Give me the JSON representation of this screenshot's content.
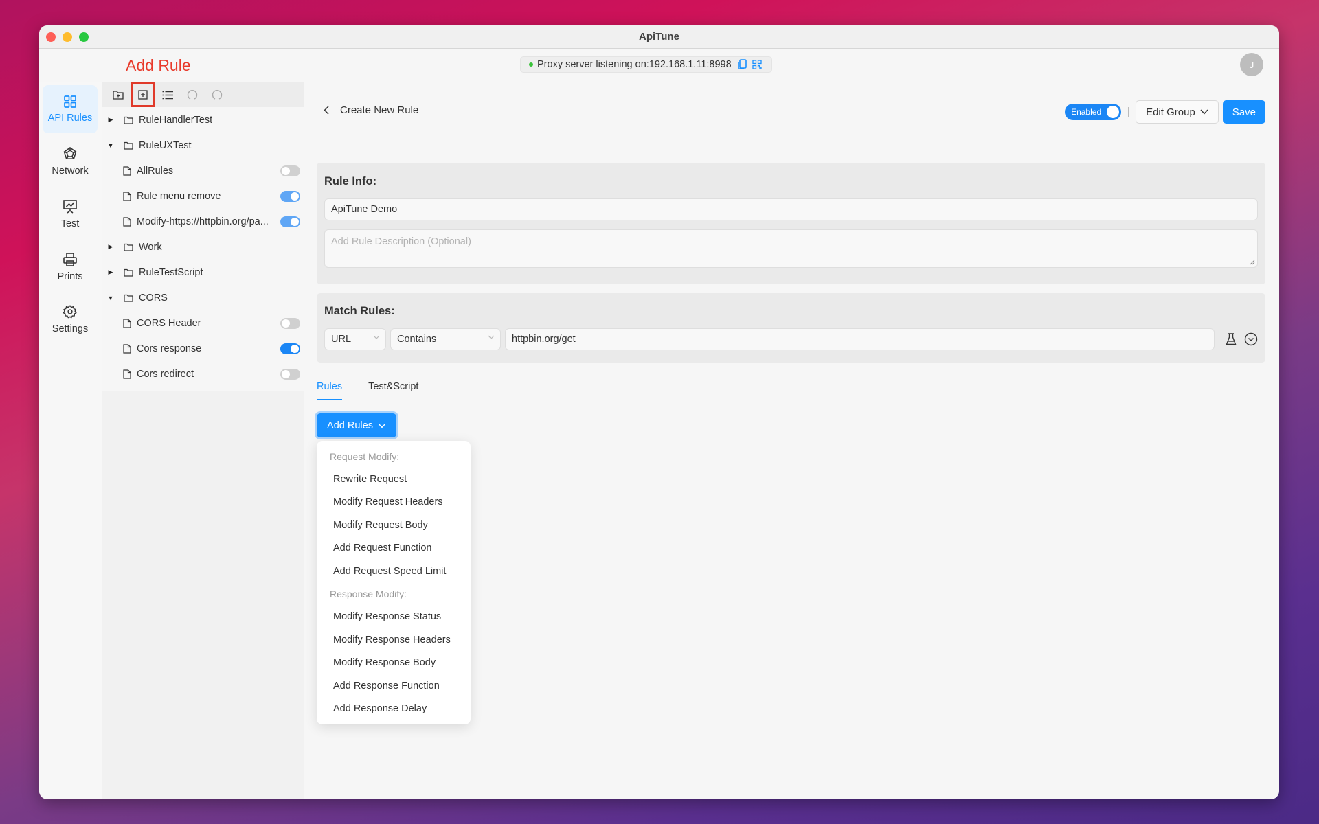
{
  "window": {
    "title": "ApiTune"
  },
  "annotation": {
    "label": "Add Rule",
    "color": "#e8392a"
  },
  "proxy": {
    "status_text": "Proxy server listening on:192.168.1.11:8998",
    "status_color": "#3ac23a",
    "copy_icon": "copy-icon",
    "qr_icon": "qrcode-icon"
  },
  "user": {
    "avatar_initial": "J"
  },
  "rail": {
    "items": [
      {
        "label": "API Rules",
        "icon": "grid-icon",
        "active": true
      },
      {
        "label": "Network",
        "icon": "network-icon"
      },
      {
        "label": "Test",
        "icon": "presentation-chart-icon"
      },
      {
        "label": "Prints",
        "icon": "printer-icon"
      },
      {
        "label": "Settings",
        "icon": "gear-icon"
      }
    ]
  },
  "tree": {
    "toolbar": [
      "new-folder-icon",
      "add-rule-icon",
      "list-icon",
      "undo-icon",
      "redo-icon"
    ],
    "nodes": [
      {
        "type": "folder",
        "name": "RuleHandlerTest",
        "expanded": false
      },
      {
        "type": "folder",
        "name": "RuleUXTest",
        "expanded": true
      },
      {
        "type": "rule",
        "name": "AllRules",
        "enabled": false
      },
      {
        "type": "rule",
        "name": "Rule menu remove",
        "enabled": true
      },
      {
        "type": "rule",
        "name": "Modify-https://httpbin.org/pa...",
        "enabled": true
      },
      {
        "type": "folder",
        "name": "Work",
        "expanded": false
      },
      {
        "type": "folder",
        "name": "RuleTestScript",
        "expanded": false
      },
      {
        "type": "folder",
        "name": "CORS",
        "expanded": true
      },
      {
        "type": "rule",
        "name": "CORS Header",
        "enabled": false
      },
      {
        "type": "rule",
        "name": "Cors response",
        "enabled": true
      },
      {
        "type": "rule",
        "name": "Cors redirect",
        "enabled": false
      }
    ]
  },
  "header": {
    "back_label": "Create New Rule",
    "enabled_label": "Enabled",
    "enabled": true,
    "edit_group_label": "Edit Group",
    "save_label": "Save"
  },
  "rule_info": {
    "title": "Rule Info:",
    "name_value": "ApiTune Demo",
    "description_placeholder": "Add Rule Description (Optional)",
    "description_value": ""
  },
  "match_rules": {
    "title": "Match Rules:",
    "field_value": "URL",
    "operator_value": "Contains",
    "pattern_value": "httpbin.org/get"
  },
  "tabs": [
    {
      "label": "Rules",
      "active": true
    },
    {
      "label": "Test&Script",
      "active": false
    }
  ],
  "add_rules": {
    "label": "Add Rules",
    "menu": [
      {
        "type": "header",
        "label": "Request Modify:"
      },
      {
        "type": "item",
        "label": "Rewrite Request"
      },
      {
        "type": "item",
        "label": "Modify Request Headers"
      },
      {
        "type": "item",
        "label": "Modify Request Body"
      },
      {
        "type": "item",
        "label": "Add Request Function"
      },
      {
        "type": "item",
        "label": "Add Request Speed Limit"
      },
      {
        "type": "header",
        "label": "Response Modify:"
      },
      {
        "type": "item",
        "label": "Modify Response Status"
      },
      {
        "type": "item",
        "label": "Modify Response Headers"
      },
      {
        "type": "item",
        "label": "Modify Response Body"
      },
      {
        "type": "item",
        "label": "Add Response Function"
      },
      {
        "type": "item",
        "label": "Add Response Delay"
      }
    ]
  },
  "colors": {
    "accent": "#1890ff",
    "toggle_on": "#1b86f5",
    "toggle_off": "#d0d0d0"
  }
}
